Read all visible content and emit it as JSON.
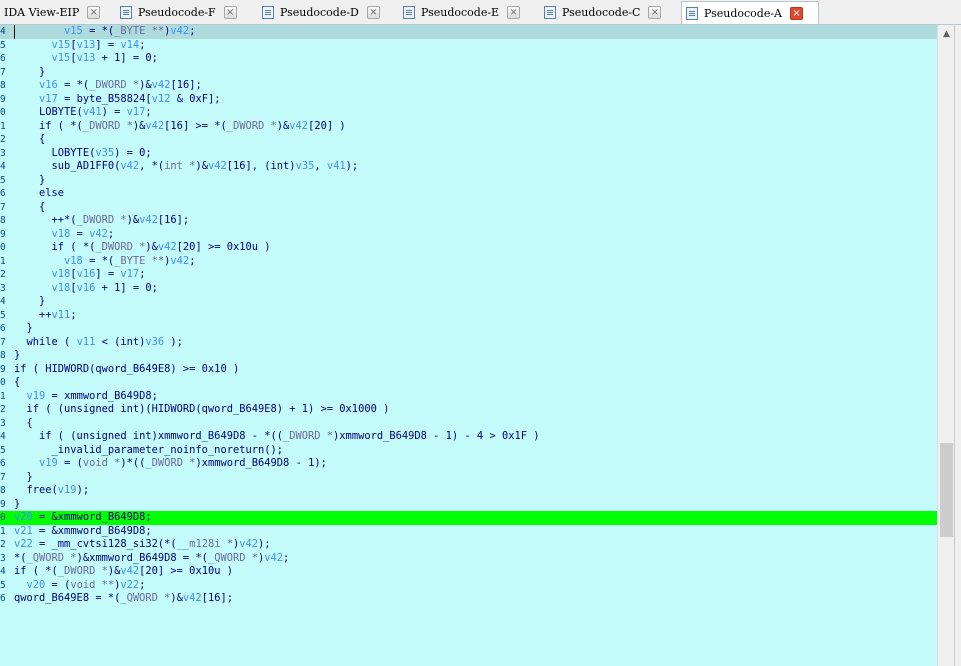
{
  "tabs": [
    {
      "label": "IDA View-EIP",
      "icon": "none",
      "active": false
    },
    {
      "label": "Pseudocode-F",
      "icon": "document-icon",
      "active": false
    },
    {
      "label": "Pseudocode-D",
      "icon": "document-icon",
      "active": false
    },
    {
      "label": "Pseudocode-E",
      "icon": "document-icon",
      "active": false
    },
    {
      "label": "Pseudocode-C",
      "icon": "document-icon",
      "active": false
    },
    {
      "label": "Pseudocode-A",
      "icon": "document-icon",
      "active": true
    }
  ],
  "close_glyph": "×",
  "scroll_up_glyph": "▲",
  "colors": {
    "code_background": "#c4fcfc",
    "highlight_line": "#00ff00",
    "current_line": "#aedcdc",
    "variable": "#3d8eff",
    "keyword_text": "#000080",
    "active_close": "#e04a2a"
  },
  "code_lines": [
    {
      "ln": "4",
      "text": "        v15 = *(_BYTE **)v42;",
      "style": "current"
    },
    {
      "ln": "5",
      "text": "      v15[v13] = v14;",
      "style": ""
    },
    {
      "ln": "6",
      "text": "      v15[v13 + 1] = 0;",
      "style": ""
    },
    {
      "ln": "7",
      "text": "    }",
      "style": ""
    },
    {
      "ln": "8",
      "text": "    v16 = *(_DWORD *)&v42[16];",
      "style": ""
    },
    {
      "ln": "9",
      "text": "    v17 = byte_B58824[v12 & 0xF];",
      "style": ""
    },
    {
      "ln": "0",
      "text": "    LOBYTE(v41) = v17;",
      "style": ""
    },
    {
      "ln": "1",
      "text": "    if ( *(_DWORD *)&v42[16] >= *(_DWORD *)&v42[20] )",
      "style": ""
    },
    {
      "ln": "2",
      "text": "    {",
      "style": ""
    },
    {
      "ln": "3",
      "text": "      LOBYTE(v35) = 0;",
      "style": ""
    },
    {
      "ln": "4",
      "text": "      sub_AD1FF0(v42, *(int *)&v42[16], (int)v35, v41);",
      "style": ""
    },
    {
      "ln": "5",
      "text": "    }",
      "style": ""
    },
    {
      "ln": "6",
      "text": "    else",
      "style": ""
    },
    {
      "ln": "7",
      "text": "    {",
      "style": ""
    },
    {
      "ln": "8",
      "text": "      ++*(_DWORD *)&v42[16];",
      "style": ""
    },
    {
      "ln": "9",
      "text": "      v18 = v42;",
      "style": ""
    },
    {
      "ln": "0",
      "text": "      if ( *(_DWORD *)&v42[20] >= 0x10u )",
      "style": ""
    },
    {
      "ln": "1",
      "text": "        v18 = *(_BYTE **)v42;",
      "style": ""
    },
    {
      "ln": "2",
      "text": "      v18[v16] = v17;",
      "style": ""
    },
    {
      "ln": "3",
      "text": "      v18[v16 + 1] = 0;",
      "style": ""
    },
    {
      "ln": "4",
      "text": "    }",
      "style": ""
    },
    {
      "ln": "5",
      "text": "    ++v11;",
      "style": ""
    },
    {
      "ln": "6",
      "text": "  }",
      "style": ""
    },
    {
      "ln": "7",
      "text": "  while ( v11 < (int)v36 );",
      "style": ""
    },
    {
      "ln": "8",
      "text": "}",
      "style": ""
    },
    {
      "ln": "9",
      "text": "if ( HIDWORD(qword_B649E8) >= 0x10 )",
      "style": ""
    },
    {
      "ln": "0",
      "text": "{",
      "style": ""
    },
    {
      "ln": "1",
      "text": "  v19 = xmmword_B649D8;",
      "style": ""
    },
    {
      "ln": "2",
      "text": "  if ( (unsigned int)(HIDWORD(qword_B649E8) + 1) >= 0x1000 )",
      "style": ""
    },
    {
      "ln": "3",
      "text": "  {",
      "style": ""
    },
    {
      "ln": "4",
      "text": "    if ( (unsigned int)xmmword_B649D8 - *((_DWORD *)xmmword_B649D8 - 1) - 4 > 0x1F )",
      "style": ""
    },
    {
      "ln": "5",
      "text": "      _invalid_parameter_noinfo_noreturn();",
      "style": ""
    },
    {
      "ln": "6",
      "text": "    v19 = (void *)*((_DWORD *)xmmword_B649D8 - 1);",
      "style": ""
    },
    {
      "ln": "7",
      "text": "  }",
      "style": ""
    },
    {
      "ln": "8",
      "text": "  free(v19);",
      "style": ""
    },
    {
      "ln": "9",
      "text": "}",
      "style": ""
    },
    {
      "ln": "0",
      "text": "v20 = &xmmword_B649D8;",
      "style": "hl"
    },
    {
      "ln": "1",
      "text": "v21 = &xmmword_B649D8;",
      "style": ""
    },
    {
      "ln": "2",
      "text": "v22 = _mm_cvtsi128_si32(*(__m128i *)v42);",
      "style": ""
    },
    {
      "ln": "3",
      "text": "*(_QWORD *)&xmmword_B649D8 = *(_QWORD *)v42;",
      "style": ""
    },
    {
      "ln": "4",
      "text": "if ( *(_DWORD *)&v42[20] >= 0x10u )",
      "style": ""
    },
    {
      "ln": "5",
      "text": "  v20 = (void **)v22;",
      "style": ""
    },
    {
      "ln": "6",
      "text": "qword_B649E8 = *(_QWORD *)&v42[16];",
      "style": ""
    }
  ]
}
